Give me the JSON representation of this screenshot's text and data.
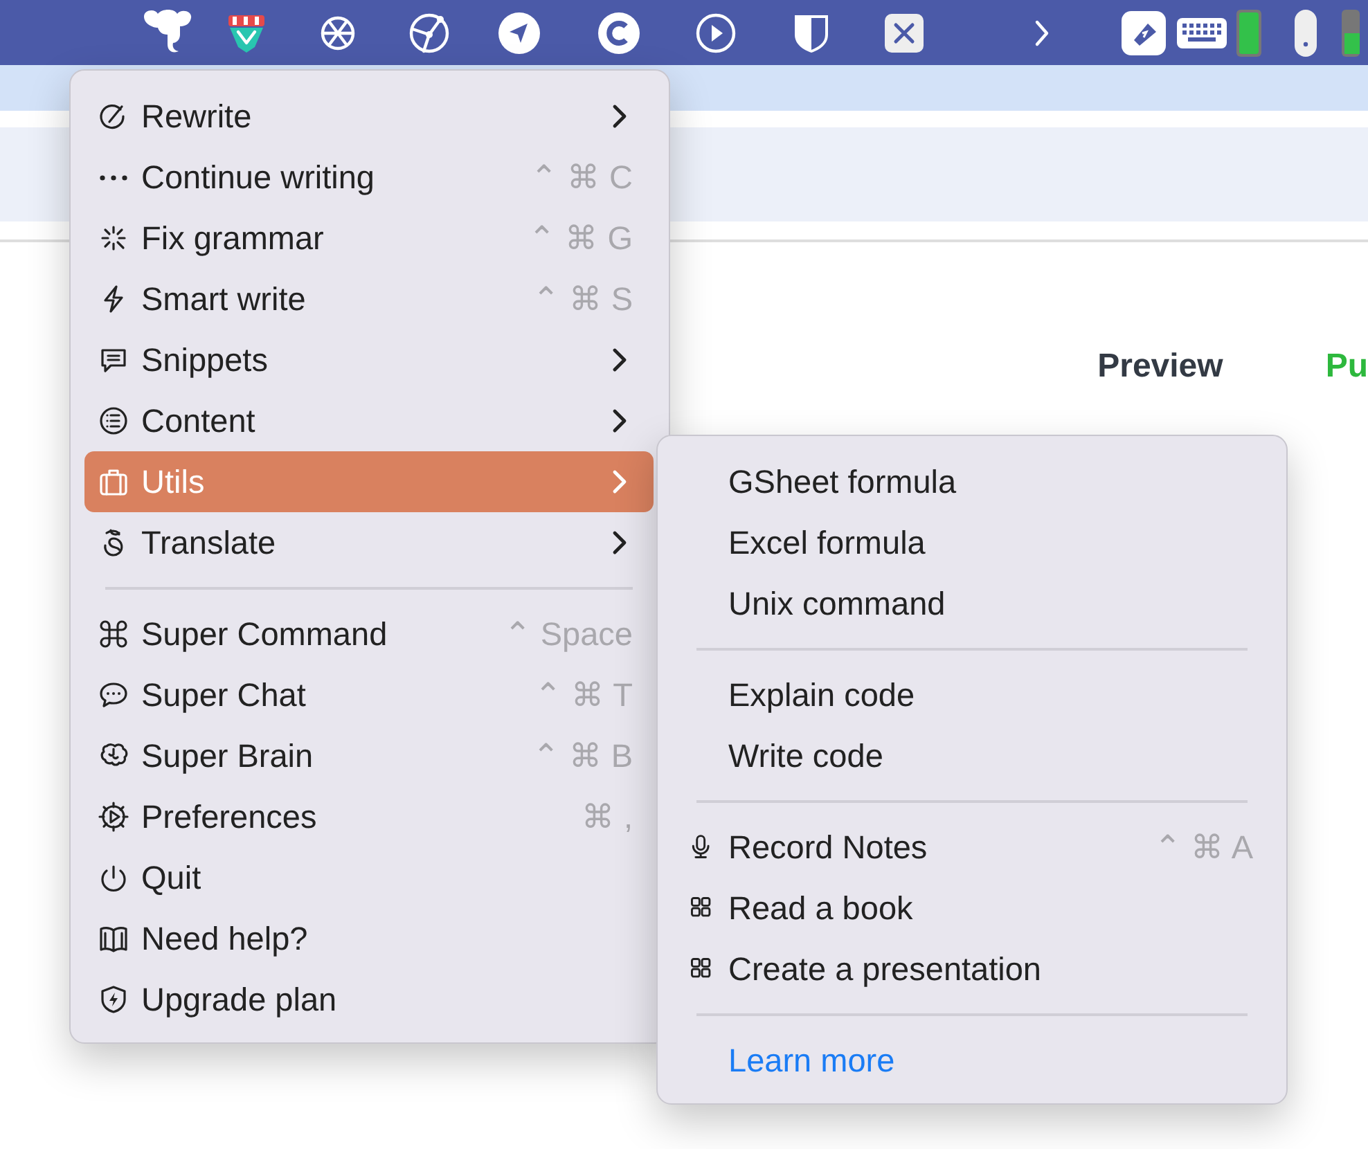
{
  "page": {
    "actions": [
      {
        "label": "Preview",
        "kind": "secondary"
      },
      {
        "label": "Pu",
        "kind": "primary"
      }
    ]
  },
  "menu": {
    "items": [
      {
        "kind": "item",
        "label": "Rewrite",
        "submenu": true,
        "selected": false
      },
      {
        "kind": "item",
        "label": "Continue writing",
        "shortcut": "⌃ ⌘ C",
        "selected": false
      },
      {
        "kind": "item",
        "label": "Fix grammar",
        "shortcut": "⌃ ⌘ G",
        "selected": false
      },
      {
        "kind": "item",
        "label": "Smart write",
        "shortcut": "⌃ ⌘ S",
        "selected": false
      },
      {
        "kind": "item",
        "label": "Snippets",
        "submenu": true,
        "selected": false
      },
      {
        "kind": "item",
        "label": "Content",
        "submenu": true,
        "selected": false
      },
      {
        "kind": "item",
        "label": "Utils",
        "submenu": true,
        "selected": true
      },
      {
        "kind": "item",
        "label": "Translate",
        "submenu": true,
        "selected": false
      },
      {
        "kind": "separator"
      },
      {
        "kind": "item",
        "label": "Super Command",
        "shortcut": "⌃ Space",
        "selected": false
      },
      {
        "kind": "item",
        "label": "Super Chat",
        "shortcut": "⌃ ⌘ T",
        "selected": false
      },
      {
        "kind": "item",
        "label": "Super Brain",
        "shortcut": "⌃ ⌘ B",
        "selected": false
      },
      {
        "kind": "item",
        "label": "Preferences",
        "shortcut": "⌘ ,",
        "selected": false
      },
      {
        "kind": "item",
        "label": "Quit",
        "selected": false
      },
      {
        "kind": "item",
        "label": "Need help?",
        "selected": false
      },
      {
        "kind": "item",
        "label": "Upgrade plan",
        "selected": false
      }
    ]
  },
  "submenu": {
    "items": [
      {
        "kind": "item",
        "label": "GSheet formula",
        "selected": false
      },
      {
        "kind": "item",
        "label": "Excel formula",
        "selected": false
      },
      {
        "kind": "item",
        "label": "Unix command",
        "selected": false
      },
      {
        "kind": "separator"
      },
      {
        "kind": "item",
        "label": "Explain code",
        "selected": false
      },
      {
        "kind": "item",
        "label": "Write code",
        "selected": false
      },
      {
        "kind": "separator"
      },
      {
        "kind": "item",
        "label": "Record Notes",
        "shortcut": "⌃ ⌘ A",
        "selected": false
      },
      {
        "kind": "item",
        "label": "Read a book",
        "selected": false
      },
      {
        "kind": "item",
        "label": "Create a presentation",
        "selected": false
      },
      {
        "kind": "separator"
      },
      {
        "kind": "link",
        "label": "Learn more"
      }
    ]
  }
}
